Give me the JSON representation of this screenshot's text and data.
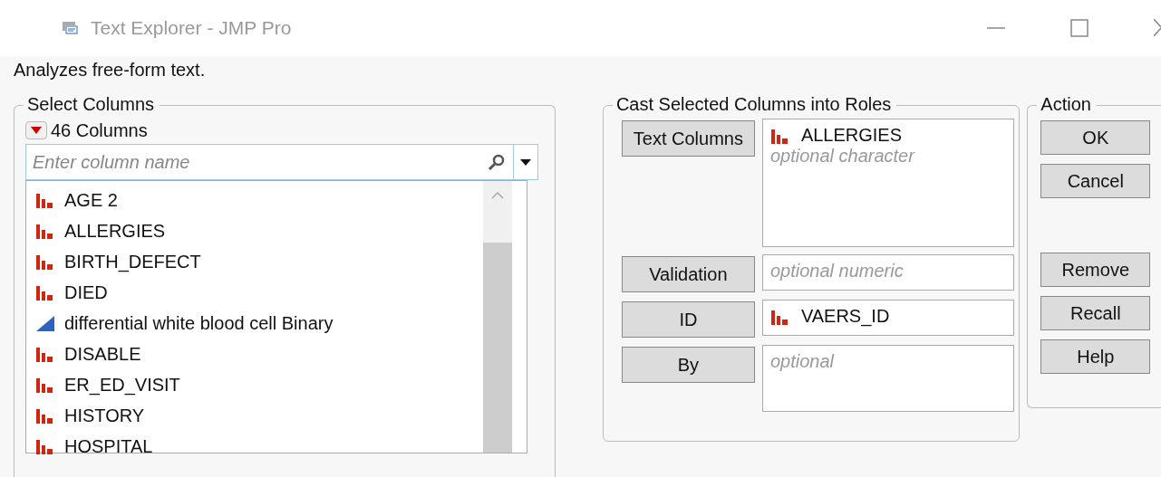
{
  "window": {
    "title": "Text Explorer - JMP Pro"
  },
  "description": "Analyzes free-form text.",
  "select_columns": {
    "title": "Select Columns",
    "count": "46 Columns",
    "search": {
      "placeholder": "Enter column name"
    },
    "columns": [
      {
        "name": "AGE 2",
        "kind": "nominal"
      },
      {
        "name": "ALLERGIES",
        "kind": "nominal"
      },
      {
        "name": "BIRTH_DEFECT",
        "kind": "nominal"
      },
      {
        "name": "DIED",
        "kind": "nominal"
      },
      {
        "name": "differential white blood cell Binary",
        "kind": "continuous"
      },
      {
        "name": "DISABLE",
        "kind": "nominal"
      },
      {
        "name": "ER_ED_VISIT",
        "kind": "nominal"
      },
      {
        "name": "HISTORY",
        "kind": "nominal"
      },
      {
        "name": "HOSPITAL",
        "kind": "nominal"
      }
    ]
  },
  "roles": {
    "title": "Cast Selected Columns into Roles",
    "rows": [
      {
        "button": "Text Columns",
        "items": [
          {
            "name": "ALLERGIES",
            "kind": "nominal"
          }
        ],
        "hint": "optional character"
      },
      {
        "button": "Validation",
        "items": [],
        "hint": "optional numeric"
      },
      {
        "button": "ID",
        "items": [
          {
            "name": "VAERS_ID",
            "kind": "nominal"
          }
        ]
      },
      {
        "button": "By",
        "items": [],
        "hint": "optional"
      }
    ]
  },
  "action": {
    "title": "Action",
    "buttons": [
      {
        "label": "OK"
      },
      {
        "label": "Cancel"
      },
      {
        "label": "Remove"
      },
      {
        "label": "Recall"
      },
      {
        "label": "Help"
      }
    ]
  }
}
